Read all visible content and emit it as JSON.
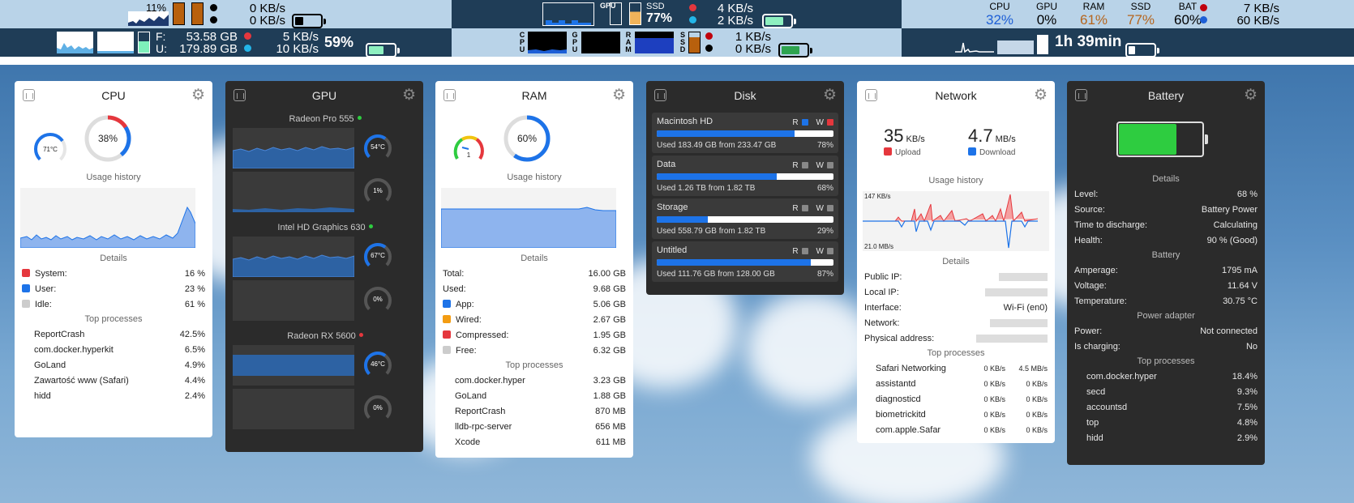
{
  "menubar_row1": {
    "seg1": {
      "cpu_pct": "11%",
      "up": "0 KB/s",
      "down": "0 KB/s"
    },
    "seg2": {
      "gpu_label": "GPU",
      "ssd_label": "SSD",
      "ssd_pct": "77%",
      "up": "4 KB/s",
      "down": "2 KB/s"
    },
    "seg3": {
      "stats": [
        {
          "label": "CPU",
          "value": "32%",
          "color": "#1d5fd6"
        },
        {
          "label": "GPU",
          "value": "0%",
          "color": "#000000"
        },
        {
          "label": "RAM",
          "value": "61%",
          "color": "#b5651d"
        },
        {
          "label": "SSD",
          "value": "77%",
          "color": "#b5651d"
        },
        {
          "label": "BAT",
          "value": "60%",
          "color": "#000000"
        }
      ],
      "up": "7 KB/s",
      "down": "60 KB/s"
    }
  },
  "menubar_row2": {
    "seg1": {
      "f_label": "F:",
      "f_value": "53.58 GB",
      "u_label": "U:",
      "u_value": "179.89 GB",
      "up": "5 KB/s",
      "down": "10 KB/s",
      "bat_pct": "59%"
    },
    "seg2": {
      "cpu_label": "CPU",
      "gpu_label": "GPU",
      "ram_label": "RAM",
      "ssd_label": "SSD",
      "up": "1 KB/s",
      "down": "0 KB/s"
    },
    "seg3": {
      "time": "1h 39min"
    }
  },
  "cpu": {
    "title": "CPU",
    "temp": "71°C",
    "usage": "38%",
    "usage_fraction": 0.38,
    "history_label": "Usage history",
    "details_label": "Details",
    "details": [
      {
        "label": "System:",
        "value": "16 %",
        "color": "#e5373d"
      },
      {
        "label": "User:",
        "value": "23 %",
        "color": "#1d73e8"
      },
      {
        "label": "Idle:",
        "value": "61 %",
        "color": "#cccccc"
      }
    ],
    "top_label": "Top processes",
    "processes": [
      {
        "name": "ReportCrash",
        "value": "42.5%"
      },
      {
        "name": "com.docker.hyperkit",
        "value": "6.5%"
      },
      {
        "name": "GoLand",
        "value": "4.9%"
      },
      {
        "name": "Zawartość www (Safari)",
        "value": "4.4%"
      },
      {
        "name": "hidd",
        "value": "2.4%"
      }
    ]
  },
  "gpu": {
    "title": "GPU",
    "cards": [
      {
        "name": "Radeon Pro 555",
        "status_color": "#2ecc40",
        "temp": "54°C",
        "usage": "1%"
      },
      {
        "name": "Intel HD Graphics 630",
        "status_color": "#2ecc40",
        "temp": "67°C",
        "usage": "0%"
      },
      {
        "name": "Radeon RX 5600",
        "status_color": "#e5373d",
        "temp": "46°C",
        "usage": "0%"
      }
    ]
  },
  "ram": {
    "title": "RAM",
    "pressure": "1",
    "usage": "60%",
    "usage_fraction": 0.6,
    "history_label": "Usage history",
    "details_label": "Details",
    "details": [
      {
        "label": "Total:",
        "value": "16.00 GB",
        "color": ""
      },
      {
        "label": "Used:",
        "value": "9.68 GB",
        "color": ""
      },
      {
        "label": "App:",
        "value": "5.06 GB",
        "color": "#1d73e8"
      },
      {
        "label": "Wired:",
        "value": "2.67 GB",
        "color": "#f39c12"
      },
      {
        "label": "Compressed:",
        "value": "1.95 GB",
        "color": "#e5373d"
      },
      {
        "label": "Free:",
        "value": "6.32 GB",
        "color": "#cccccc"
      }
    ],
    "top_label": "Top processes",
    "processes": [
      {
        "name": "com.docker.hyper",
        "value": "3.23 GB"
      },
      {
        "name": "GoLand",
        "value": "1.88 GB"
      },
      {
        "name": "ReportCrash",
        "value": "870 MB"
      },
      {
        "name": "lldb-rpc-server",
        "value": "656 MB"
      },
      {
        "name": "Xcode",
        "value": "611 MB"
      }
    ]
  },
  "disk": {
    "title": "Disk",
    "items": [
      {
        "name": "Macintosh HD",
        "used": "Used 183.49 GB from 233.47 GB",
        "pct": "78%",
        "fraction": 0.78,
        "r_color": "#1d73e8",
        "w_color": "#e5373d"
      },
      {
        "name": "Data",
        "used": "Used 1.26 TB from 1.82 TB",
        "pct": "68%",
        "fraction": 0.68,
        "r_color": "#888888",
        "w_color": "#888888"
      },
      {
        "name": "Storage",
        "used": "Used 558.79 GB from 1.82 TB",
        "pct": "29%",
        "fraction": 0.29,
        "r_color": "#888888",
        "w_color": "#888888"
      },
      {
        "name": "Untitled",
        "used": "Used 111.76 GB from 128.00 GB",
        "pct": "87%",
        "fraction": 0.87,
        "r_color": "#888888",
        "w_color": "#888888"
      }
    ],
    "r_label": "R",
    "w_label": "W"
  },
  "network": {
    "title": "Network",
    "upload_value": "35",
    "upload_unit": "KB/s",
    "upload_label": "Upload",
    "download_value": "4.7",
    "download_unit": "MB/s",
    "download_label": "Download",
    "history_label": "Usage history",
    "max_label": "147 KB/s",
    "min_label": "21.0 MB/s",
    "details_label": "Details",
    "details": [
      {
        "label": "Public IP:",
        "value": ""
      },
      {
        "label": "Local IP:",
        "value": ""
      },
      {
        "label": "Interface:",
        "value": "Wi-Fi (en0)"
      },
      {
        "label": "Network:",
        "value": ""
      },
      {
        "label": "Physical address:",
        "value": ""
      }
    ],
    "top_label": "Top processes",
    "processes": [
      {
        "name": "Safari Networking",
        "up": "0 KB/s",
        "down": "4.5 MB/s"
      },
      {
        "name": "assistantd",
        "up": "0 KB/s",
        "down": "0 KB/s"
      },
      {
        "name": "diagnosticd",
        "up": "0 KB/s",
        "down": "0 KB/s"
      },
      {
        "name": "biometrickitd",
        "up": "0 KB/s",
        "down": "0 KB/s"
      },
      {
        "name": "com.apple.Safar",
        "up": "0 KB/s",
        "down": "0 KB/s"
      }
    ]
  },
  "battery": {
    "title": "Battery",
    "level_fraction": 0.68,
    "details_label": "Details",
    "details": [
      {
        "label": "Level:",
        "value": "68 %"
      },
      {
        "label": "Source:",
        "value": "Battery Power"
      },
      {
        "label": "Time to discharge:",
        "value": "Calculating"
      },
      {
        "label": "Health:",
        "value": "90 % (Good)"
      }
    ],
    "battery_label": "Battery",
    "battery_rows": [
      {
        "label": "Amperage:",
        "value": "1795 mA"
      },
      {
        "label": "Voltage:",
        "value": "11.64 V"
      },
      {
        "label": "Temperature:",
        "value": "30.75 °C"
      }
    ],
    "adapter_label": "Power adapter",
    "adapter_rows": [
      {
        "label": "Power:",
        "value": "Not connected"
      },
      {
        "label": "Is charging:",
        "value": "No"
      }
    ],
    "top_label": "Top processes",
    "processes": [
      {
        "name": "com.docker.hyper",
        "value": "18.4%"
      },
      {
        "name": "secd",
        "value": "9.3%"
      },
      {
        "name": "accountsd",
        "value": "7.5%"
      },
      {
        "name": "top",
        "value": "4.8%"
      },
      {
        "name": "hidd",
        "value": "2.9%"
      }
    ]
  }
}
